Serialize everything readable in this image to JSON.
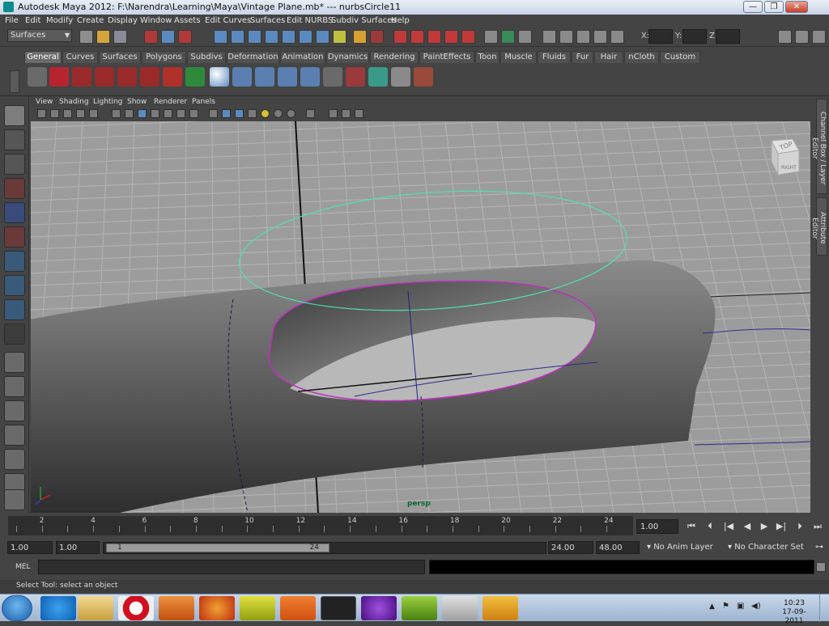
{
  "window": {
    "title": "Autodesk Maya 2012: F:\\Narendra\\Learning\\Maya\\Vintage Plane.mb*  ---  nurbsCircle11",
    "minimize": "—",
    "maximize": "❐",
    "close": "✕"
  },
  "menubar": {
    "items": [
      "File",
      "Edit",
      "Modify",
      "Create",
      "Display",
      "Window",
      "Assets",
      "Edit Curves",
      "Surfaces",
      "Edit NURBS",
      "Subdiv Surfaces",
      "Help"
    ]
  },
  "statusline": {
    "mode": "Surfaces",
    "x_label": "X:",
    "y_label": "Y:",
    "z_label": "Z:"
  },
  "shelf": {
    "tabs": [
      "General",
      "Curves",
      "Surfaces",
      "Polygons",
      "Subdivs",
      "Deformation",
      "Animation",
      "Dynamics",
      "Rendering",
      "PaintEffects",
      "Toon",
      "Muscle",
      "Fluids",
      "Fur",
      "Hair",
      "nCloth",
      "Custom"
    ],
    "active_tab": "General"
  },
  "panel": {
    "menus": [
      "View",
      "Shading",
      "Lighting",
      "Show",
      "Renderer",
      "Panels"
    ],
    "camera": "persp",
    "viewcube_top": "TOP",
    "viewcube_right": "RIGHT"
  },
  "side_tabs": {
    "channel_box": "Channel Box / Layer Editor",
    "attribute_editor": "Attribute Editor"
  },
  "timeline": {
    "tick_labels": [
      "2",
      "4",
      "6",
      "8",
      "10",
      "12",
      "14",
      "16",
      "18",
      "20",
      "22",
      "24"
    ],
    "current_time": "1.00"
  },
  "range": {
    "start": "1.00",
    "playback_start": "1.00",
    "handle_start": "1",
    "handle_end": "24",
    "playback_end": "24.00",
    "end": "48.00",
    "anim_layer": "No Anim Layer",
    "character_set": "No Character Set"
  },
  "command": {
    "language": "MEL"
  },
  "helpline": {
    "text": "Select Tool: select an object"
  },
  "taskbar": {
    "time": "10:23",
    "date": "17-09-2011"
  },
  "colors": {
    "viewport_bg": "#9c9c9c",
    "curve_green": "#4fe0b0",
    "curve_magenta": "#c030c0",
    "grid_line": "#b4b4b4"
  }
}
